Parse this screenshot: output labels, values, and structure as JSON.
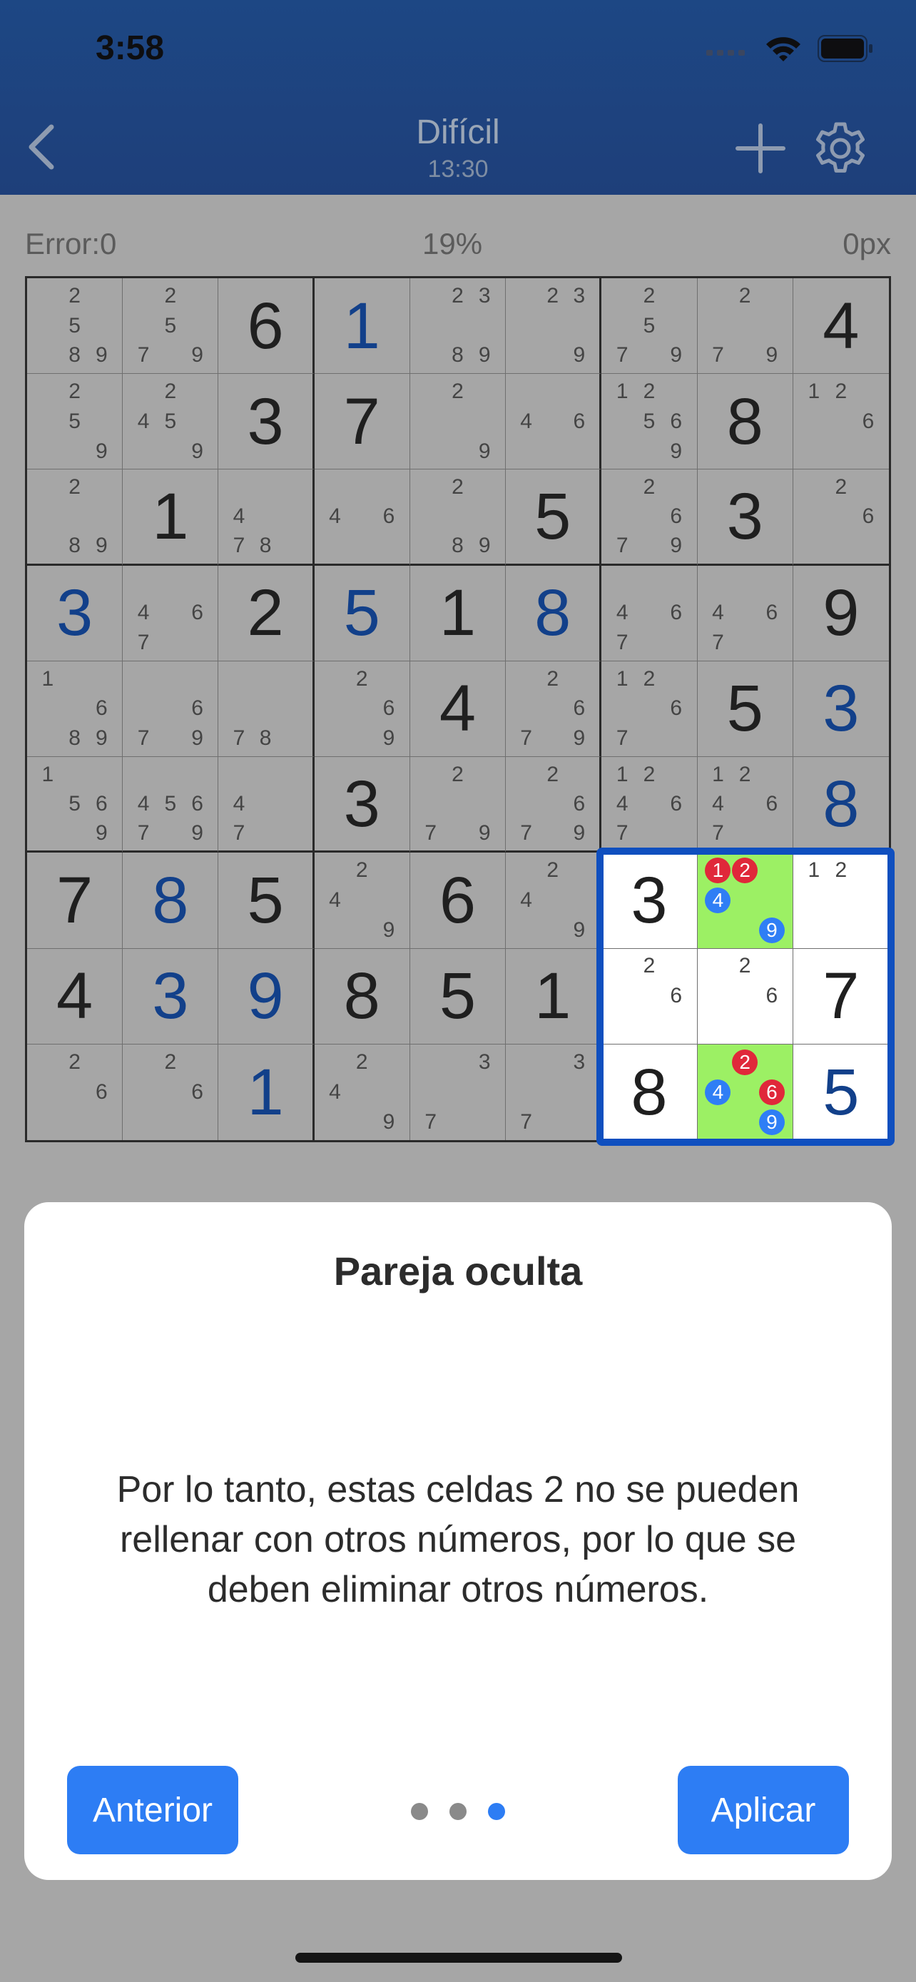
{
  "status_bar": {
    "time": "3:58"
  },
  "nav": {
    "title": "Difícil",
    "timer": "13:30"
  },
  "info": {
    "errors": "Error:0",
    "progress": "19%",
    "extra": "0px"
  },
  "cells": [
    [
      {
        "n": [
          2,
          5,
          8,
          9
        ]
      },
      {
        "n": [
          2,
          5,
          7,
          9
        ]
      },
      {
        "v": "6"
      },
      {
        "v": "1",
        "u": true
      },
      {
        "n": [
          2,
          3,
          8,
          9
        ]
      },
      {
        "n": [
          2,
          3,
          9
        ]
      },
      {
        "n": [
          2,
          5,
          7,
          9
        ]
      },
      {
        "n": [
          2,
          7,
          9
        ]
      },
      {
        "v": "4"
      }
    ],
    [
      {
        "n": [
          2,
          5,
          9
        ]
      },
      {
        "n": [
          2,
          4,
          5,
          9
        ]
      },
      {
        "v": "3"
      },
      {
        "v": "7"
      },
      {
        "n": [
          2,
          9
        ]
      },
      {
        "n": [
          4,
          6
        ]
      },
      {
        "n": [
          1,
          2,
          5,
          6,
          9
        ]
      },
      {
        "v": "8"
      },
      {
        "n": [
          1,
          2,
          6
        ]
      }
    ],
    [
      {
        "n": [
          2,
          8,
          9
        ]
      },
      {
        "v": "1"
      },
      {
        "n": [
          4,
          7,
          8
        ]
      },
      {
        "n": [
          4,
          6
        ]
      },
      {
        "n": [
          2,
          8,
          9
        ]
      },
      {
        "v": "5"
      },
      {
        "n": [
          2,
          6,
          7,
          9
        ]
      },
      {
        "v": "3"
      },
      {
        "n": [
          2,
          6
        ]
      }
    ],
    [
      {
        "v": "3",
        "u": true
      },
      {
        "n": [
          4,
          6,
          7
        ]
      },
      {
        "v": "2"
      },
      {
        "v": "5",
        "u": true
      },
      {
        "v": "1"
      },
      {
        "v": "8",
        "u": true
      },
      {
        "n": [
          4,
          6,
          7
        ]
      },
      {
        "n": [
          4,
          6,
          7
        ]
      },
      {
        "v": "9"
      }
    ],
    [
      {
        "n": [
          1,
          6,
          8,
          9
        ]
      },
      {
        "n": [
          6,
          7,
          9
        ]
      },
      {
        "n": [
          7,
          8
        ]
      },
      {
        "n": [
          2,
          6,
          9
        ]
      },
      {
        "v": "4"
      },
      {
        "n": [
          2,
          6,
          7,
          9
        ]
      },
      {
        "n": [
          1,
          2,
          6,
          7
        ]
      },
      {
        "v": "5"
      },
      {
        "v": "3",
        "u": true
      }
    ],
    [
      {
        "n": [
          1,
          5,
          6,
          9
        ]
      },
      {
        "n": [
          4,
          5,
          6,
          7,
          9
        ]
      },
      {
        "n": [
          4,
          7
        ]
      },
      {
        "v": "3"
      },
      {
        "n": [
          2,
          7,
          9
        ]
      },
      {
        "n": [
          2,
          6,
          7,
          9
        ]
      },
      {
        "n": [
          1,
          2,
          4,
          6,
          7
        ]
      },
      {
        "n": [
          1,
          2,
          4,
          6,
          7
        ]
      },
      {
        "v": "8",
        "u": true
      }
    ],
    [
      {
        "v": "7"
      },
      {
        "v": "8",
        "u": true
      },
      {
        "v": "5"
      },
      {
        "n": [
          2,
          4,
          9
        ]
      },
      {
        "v": "6"
      },
      {
        "n": [
          2,
          4,
          9
        ]
      },
      {
        "v": "3",
        "hl": "white"
      },
      {
        "b": [
          [
            1,
            "red"
          ],
          [
            2,
            "red"
          ],
          [
            4,
            "blue"
          ],
          [
            9,
            "blue"
          ]
        ],
        "hl": "green"
      },
      {
        "n": [
          1,
          2
        ],
        "hl": "white"
      }
    ],
    [
      {
        "v": "4"
      },
      {
        "v": "3",
        "u": true
      },
      {
        "v": "9",
        "u": true
      },
      {
        "v": "8"
      },
      {
        "v": "5"
      },
      {
        "v": "1"
      },
      {
        "n": [
          2,
          6
        ],
        "hl": "white"
      },
      {
        "n": [
          2,
          6
        ],
        "hl": "white"
      },
      {
        "v": "7",
        "hl": "white"
      }
    ],
    [
      {
        "n": [
          2,
          6
        ]
      },
      {
        "n": [
          2,
          6
        ]
      },
      {
        "v": "1",
        "u": true
      },
      {
        "n": [
          2,
          4,
          9
        ]
      },
      {
        "n": [
          3,
          7
        ]
      },
      {
        "n": [
          3,
          7
        ]
      },
      {
        "v": "8",
        "hl": "white"
      },
      {
        "b": [
          [
            2,
            "red"
          ],
          [
            4,
            "blue"
          ],
          [
            6,
            "red"
          ],
          [
            9,
            "blue"
          ]
        ],
        "hl": "green"
      },
      {
        "v": "5",
        "u": true,
        "hl": "white"
      }
    ]
  ],
  "modal": {
    "title": "Pareja oculta",
    "body": "Por lo tanto, estas celdas 2 no se pueden rellenar con otros números, por lo que se deben eliminar otros números.",
    "prev_label": "Anterior",
    "apply_label": "Aplicar",
    "pages": 3,
    "current_page": 3
  },
  "colors": {
    "header": "#1d4784",
    "accent": "#2d7df4",
    "green_highlight": "#9cf064",
    "badge_red": "#e0283a",
    "badge_blue": "#2f7ef5",
    "user_digit": "#12408a"
  },
  "icons": {
    "back": "chevron-left-icon",
    "add": "plus-icon",
    "settings": "gear-icon"
  }
}
